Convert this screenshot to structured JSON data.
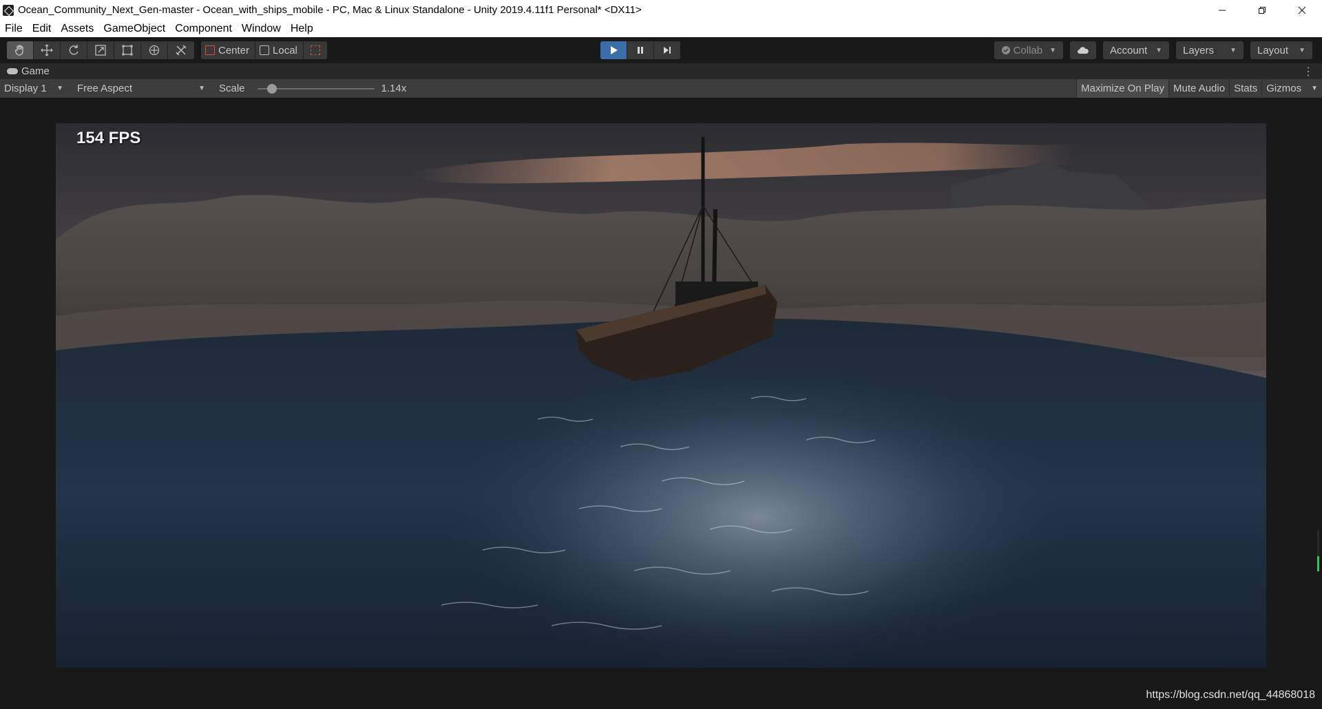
{
  "window": {
    "title": "Ocean_Community_Next_Gen-master - Ocean_with_ships_mobile - PC, Mac & Linux Standalone - Unity 2019.4.11f1 Personal* <DX11>",
    "controls": [
      "minimize",
      "restore",
      "close"
    ]
  },
  "menu": {
    "items": [
      "File",
      "Edit",
      "Assets",
      "GameObject",
      "Component",
      "Window",
      "Help"
    ]
  },
  "toolbar": {
    "tools": [
      {
        "icon": "hand-tool-icon",
        "active": true
      },
      {
        "icon": "move-tool-icon",
        "active": false
      },
      {
        "icon": "rotate-tool-icon",
        "active": false
      },
      {
        "icon": "scale-tool-icon",
        "active": false
      },
      {
        "icon": "rect-tool-icon",
        "active": false
      },
      {
        "icon": "transform-tool-icon",
        "active": false
      },
      {
        "icon": "custom-tool-icon",
        "active": false
      }
    ],
    "pivot_label": "Center",
    "space_label": "Local",
    "play": {
      "playing": true
    },
    "collab_label": "Collab",
    "account_label": "Account",
    "layers_label": "Layers",
    "layout_label": "Layout"
  },
  "game_tab": {
    "label": "Game"
  },
  "game_controls": {
    "display": "Display 1",
    "aspect": "Free Aspect",
    "scale_label": "Scale",
    "scale_value": "1.14x",
    "maximize_on_play": "Maximize On Play",
    "mute_audio": "Mute Audio",
    "stats": "Stats",
    "gizmos": "Gizmos"
  },
  "game_view": {
    "fps_text": "154 FPS"
  },
  "watermark": "https://blog.csdn.net/qq_44868018",
  "colors": {
    "play_active": "#3b6ea8",
    "editor_bg": "#191919",
    "panel": "#3c3c3c"
  }
}
